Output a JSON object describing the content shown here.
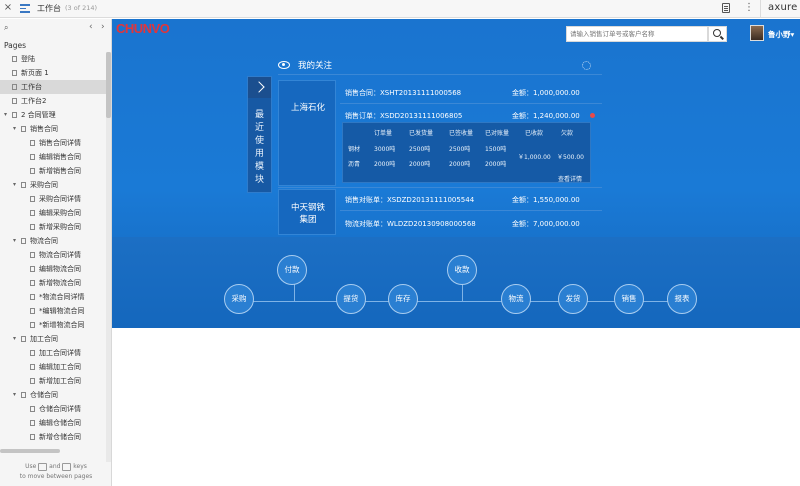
{
  "toolbar": {
    "close_glyph": "×",
    "title": "工作台",
    "count": "(3 of 214)",
    "more_glyph": "⋮",
    "brand": "axure"
  },
  "sidebar": {
    "search_glyph": "⌕",
    "prev_glyph": "‹",
    "next_glyph": "›",
    "pages_title": "Pages",
    "tree": [
      {
        "label": "登陆",
        "level": 0,
        "type": "page"
      },
      {
        "label": "新页面 1",
        "level": 0,
        "type": "page"
      },
      {
        "label": "工作台",
        "level": 0,
        "type": "page",
        "selected": true
      },
      {
        "label": "工作台2",
        "level": 0,
        "type": "page"
      },
      {
        "label": "2 合同管理",
        "level": 0,
        "type": "folder"
      },
      {
        "label": "销售合同",
        "level": 1,
        "type": "folder"
      },
      {
        "label": "销售合同详情",
        "level": 2,
        "type": "page"
      },
      {
        "label": "编辑销售合同",
        "level": 2,
        "type": "page"
      },
      {
        "label": "新增销售合同",
        "level": 2,
        "type": "page"
      },
      {
        "label": "采购合同",
        "level": 1,
        "type": "folder"
      },
      {
        "label": "采购合同详情",
        "level": 2,
        "type": "page"
      },
      {
        "label": "编辑采购合同",
        "level": 2,
        "type": "page"
      },
      {
        "label": "新增采购合同",
        "level": 2,
        "type": "page"
      },
      {
        "label": "物流合同",
        "level": 1,
        "type": "folder"
      },
      {
        "label": "物流合同详情",
        "level": 2,
        "type": "page"
      },
      {
        "label": "编辑物流合同",
        "level": 2,
        "type": "page"
      },
      {
        "label": "新增物流合同",
        "level": 2,
        "type": "page"
      },
      {
        "label": "*物流合同详情",
        "level": 2,
        "type": "page"
      },
      {
        "label": "*编辑物流合同",
        "level": 2,
        "type": "page"
      },
      {
        "label": "*新增物流合同",
        "level": 2,
        "type": "page"
      },
      {
        "label": "加工合同",
        "level": 1,
        "type": "folder"
      },
      {
        "label": "加工合同详情",
        "level": 2,
        "type": "page"
      },
      {
        "label": "编辑加工合同",
        "level": 2,
        "type": "page"
      },
      {
        "label": "新增加工合同",
        "level": 2,
        "type": "page"
      },
      {
        "label": "仓储合同",
        "level": 1,
        "type": "folder"
      },
      {
        "label": "仓储合同详情",
        "level": 2,
        "type": "page"
      },
      {
        "label": "编辑仓储合同",
        "level": 2,
        "type": "page"
      },
      {
        "label": "新增仓储合同",
        "level": 2,
        "type": "page"
      }
    ],
    "hint_use": "Use",
    "hint_and": "and",
    "hint_keys": "keys",
    "hint_line2": "to move between pages"
  },
  "app": {
    "logo": "CHUNVO",
    "search_placeholder": "请输入销售订单号或客户名称",
    "username": "鲁小野▾",
    "vtab_text": "最近使用模块",
    "panel_title": "我的关注",
    "companies": [
      {
        "name": "上海石化",
        "lines": [
          {
            "label": "销售合同：",
            "value": "XSHT20131111000568",
            "amount_label": "金额：",
            "amount": "1,000,000.00"
          },
          {
            "label": "销售订单：",
            "value": "XSDD20131111006805",
            "amount_label": "金额：",
            "amount": "1,240,000.00"
          }
        ],
        "table": {
          "headers": [
            "订单量",
            "已发货量",
            "已签收量",
            "已对账量",
            "已收款",
            "欠款"
          ],
          "rows": [
            {
              "name": "钢材",
              "cells": [
                "3000吨",
                "2500吨",
                "2500吨",
                "1500吨"
              ]
            },
            {
              "name": "沥青",
              "cells": [
                "2000吨",
                "2000吨",
                "2000吨",
                "2000吨"
              ]
            }
          ],
          "received": "￥1,000.00",
          "owed": "￥500.00",
          "detail_link": "查看详情"
        }
      },
      {
        "name": "中天钢铁集团",
        "name_line1": "中天钢铁",
        "name_line2": "集团",
        "lines": [
          {
            "label": "销售对账单：",
            "value": "XSDZD20131111005544",
            "amount_label": "金额：",
            "amount": "1,550,000.00"
          },
          {
            "label": "物流对账单：",
            "value": "WLDZD20130908000568",
            "amount_label": "金额：",
            "amount": "7,000,000.00"
          }
        ]
      }
    ],
    "flow": {
      "nodes": [
        "采购",
        "付款",
        "提货",
        "库存",
        "收款",
        "物流",
        "发货",
        "销售",
        "报表"
      ]
    }
  }
}
